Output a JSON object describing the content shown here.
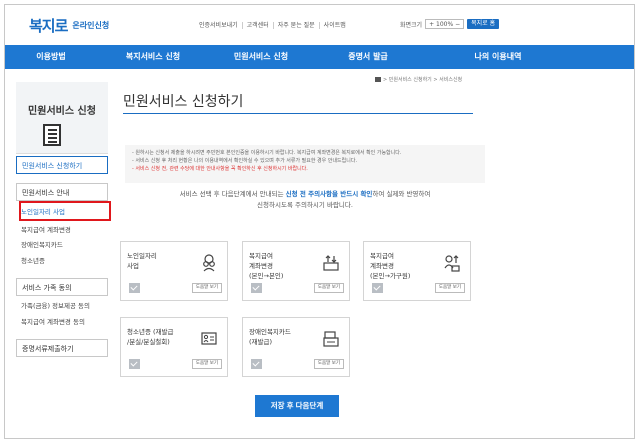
{
  "header": {
    "logo_text": "복지로",
    "logo_sub": "온라인신청",
    "util_links": [
      "인증서비보내기",
      "고객센터",
      "자주 묻는 질문",
      "사이트맵"
    ],
    "zoom_label": "화면크기",
    "zoom_value": "+ 100% −",
    "my_info": "복지로 홈"
  },
  "nav": {
    "items": [
      "이용방법",
      "복지서비스 신청",
      "민원서비스 신청",
      "증명서 발급",
      "나의 이용내역"
    ]
  },
  "sidebar": {
    "title": "민원서비스 신청",
    "main_items": [
      "민원서비스 신청하기",
      "민원서비스 안내",
      "서비스 가족 동의",
      "증명서류제출하기"
    ],
    "sub_guide": [
      "노인일자리 사업",
      "복지급여 계좌변경",
      "장애인복지카드",
      "청소년증"
    ],
    "sub_consent": [
      "가족(금융) 정보제공 동의",
      "복지급여 계좌변경 동의"
    ]
  },
  "breadcrumb": "> 민원서비스 신청하기 > 서비스신청",
  "page_title": "민원서비스 신청하기",
  "notice": {
    "lines": [
      "- 원하시는 신청서 제출을 하시려면 주민번호 본인인증을 이용하시기 바랍니다. 복지급여 계좌변경은 복지로에서 확인 가능합니다.",
      "- 서비스 신청 후 처리 현황은 나의 이용내역에서 확인하실 수 있으며 추가 서류가 필요한 경우 안내드립니다.",
      "- 서비스 신청 전, 관련 수당에 대한 안내사항을 꼭 확인하신 후 신청하시기 바랍니다."
    ]
  },
  "guide": {
    "pre": "서비스 선택 후 다음단계에서 안내되는 ",
    "highlight": "신청 전 주의사항을 반드시 확인",
    "post": "하여 실제와 반영하여",
    "line2": "신청하시도록 주의하시기 바랍니다."
  },
  "cards": [
    {
      "label": "노인일자리\n사업",
      "view": "도움말 보기"
    },
    {
      "label": "복지급여\n계좌변경\n(본인→본인)",
      "view": "도움말 보기"
    },
    {
      "label": "복지급여\n계좌변경\n(본인→가구원)",
      "view": "도움말 보기"
    },
    {
      "label": "청소년증 (재발급\n/분실/분실철회)",
      "view": "도움말 보기"
    },
    {
      "label": "장애인복지카드\n(재발급)",
      "view": "도움말 보기"
    }
  ],
  "submit_label": "저장 후 다음단계",
  "colors": {
    "accent": "#1e78d2",
    "highlight_box": "#e0171c"
  }
}
